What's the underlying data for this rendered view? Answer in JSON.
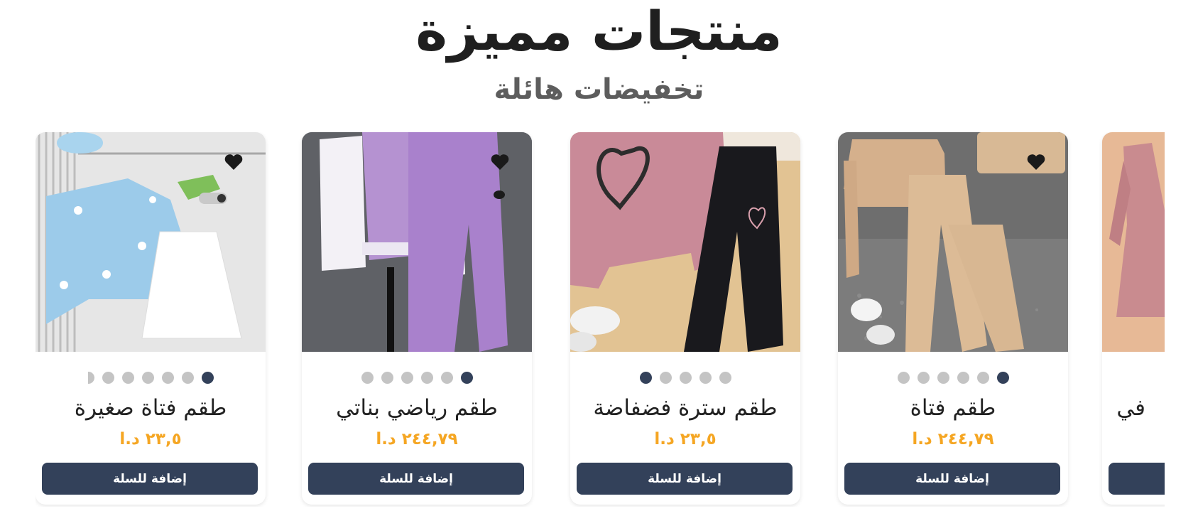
{
  "header": {
    "title": "منتجات مميزة",
    "subtitle": "تخفيضات هائلة"
  },
  "products": [
    {
      "name": "طقم فتاة صغيرة",
      "price": "٢٣,٥ د.ا",
      "button_label": "إضافة للسلة",
      "image_dots": 7,
      "active_dot": 1,
      "image": "girl-cardigan-and-skirt-set"
    },
    {
      "name": "طقم رياضي بناتي",
      "price": "٢٤٤,٧٩ د.ا",
      "button_label": "إضافة للسلة",
      "image_dots": 6,
      "active_dot": 1,
      "image": "purple-varsity-jacket-tracksuit"
    },
    {
      "name": "طقم سترة فضفاضة",
      "price": "٢٣,٥ د.ا",
      "button_label": "إضافة للسلة",
      "image_dots": 5,
      "active_dot": 5,
      "image": "pink-heart-sweatshirt-black-pants"
    },
    {
      "name": "طقم فتاة",
      "price": "٢٤٤,٧٩ د.ا",
      "button_label": "إضافة للسلة",
      "image_dots": 6,
      "active_dot": 1,
      "image": "beige-crop-top-and-trousers"
    },
    {
      "name": "في",
      "price": "",
      "button_label": "",
      "image_dots": 0,
      "active_dot": 0,
      "image": "pink-dress-partial"
    }
  ],
  "colors": {
    "accent": "#33415a",
    "price": "#f5a623",
    "dot_inactive": "#c4c4c4"
  },
  "icons": [
    "heart-icon"
  ]
}
